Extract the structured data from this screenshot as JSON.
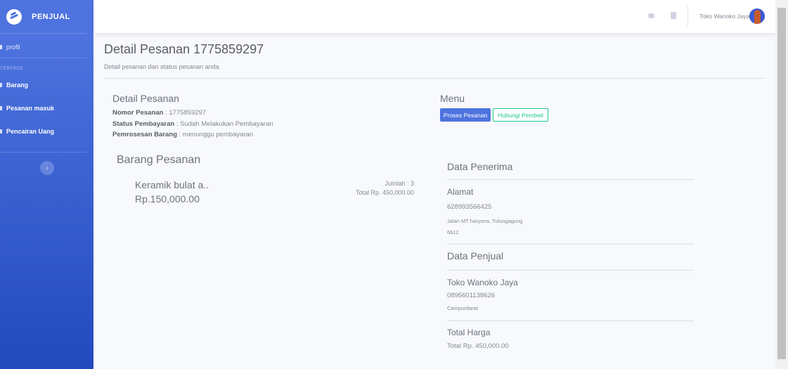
{
  "sidebar": {
    "brand": "PENJUAL",
    "profile": "profil",
    "heading": "TERFACE",
    "items": [
      {
        "label": "Barang"
      },
      {
        "label": "Pesanan masuk"
      },
      {
        "label": "Pencairan Uang"
      }
    ],
    "toggle": "‹"
  },
  "topbar": {
    "username": "Toko Wanoko Jaya"
  },
  "page": {
    "title": "Detail Pesanan 1775859297",
    "subtitle": "Detail pesanan dan status pesanan anda"
  },
  "detail": {
    "title": "Detail Pesanan",
    "nomor_label": "Nomor Pesanan",
    "nomor_value": " : 1775859297",
    "status_label": "Status Pembayaran",
    "status_value": " : Sudah Melakukan Pembayaran",
    "proses_label": "Pemrosesan Barang",
    "proses_value": " : menunggu pembayaran"
  },
  "menu": {
    "title": "Menu",
    "proses_button": "Proses Pesanan",
    "hubungi_button": "Hubungi Pembeli"
  },
  "barang": {
    "title": "Barang Pesanan",
    "name": "Keramik bulat a..",
    "price": "Rp.150,000.00",
    "jumlah": "Jumlah : 3",
    "total": "Total Rp. 450,000.00"
  },
  "penerima": {
    "title": "Data Penerima",
    "alamat_title": "Alamat",
    "phone": "628993566425",
    "address": "Jalan MT haryono, Tulungagung",
    "postcode": "6612"
  },
  "penjual": {
    "title": "Data Penjual",
    "name": "Toko Wanoko Jaya",
    "phone": "0895601138626",
    "city": "Campurdarat"
  },
  "total": {
    "title": "Total Harga",
    "value": "Total Rp. 450,000.00"
  },
  "colors": {
    "primary": "#4e73df",
    "success": "#1cc88a"
  }
}
